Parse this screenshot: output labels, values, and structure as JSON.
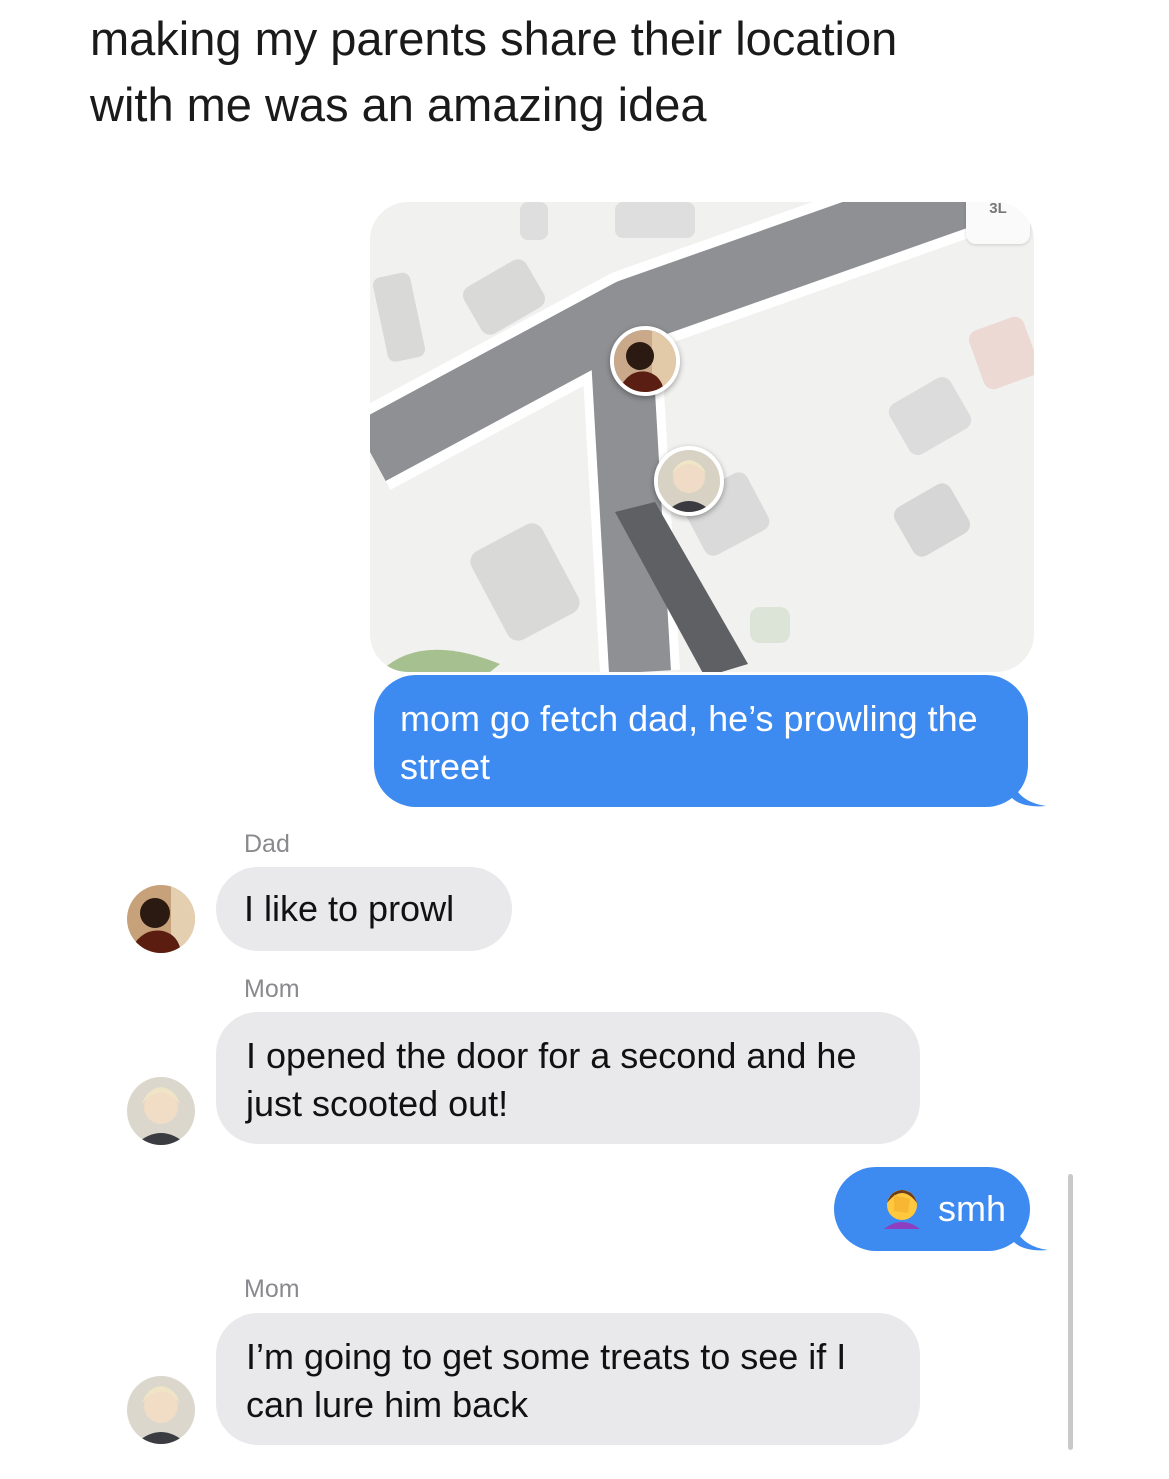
{
  "caption": {
    "line1": "making my parents share their location",
    "line2": "with me was an amazing idea"
  },
  "map": {
    "corner_tag": "3L",
    "pins": [
      {
        "person": "Dad",
        "icon": "dad-avatar-icon"
      },
      {
        "person": "Mom",
        "icon": "mom-avatar-icon"
      }
    ]
  },
  "messages": [
    {
      "from": "me",
      "text": "mom go fetch dad, he’s prowling the street"
    },
    {
      "from": "Dad",
      "sender_label": "Dad",
      "text": "I like to prowl"
    },
    {
      "from": "Mom",
      "sender_label": "Mom",
      "text": "I opened the door for a second and he just scooted out!"
    },
    {
      "from": "me",
      "emoji": "🤦‍♀️",
      "text": "smh"
    },
    {
      "from": "Mom",
      "sender_label": "Mom",
      "text": "I’m going to get some treats to see if I can lure him back"
    }
  ],
  "colors": {
    "sent_bubble": "#3d8af0",
    "received_bubble": "#e9e9eb",
    "map_road": "#8e9094",
    "map_background": "#f1f1f0"
  }
}
